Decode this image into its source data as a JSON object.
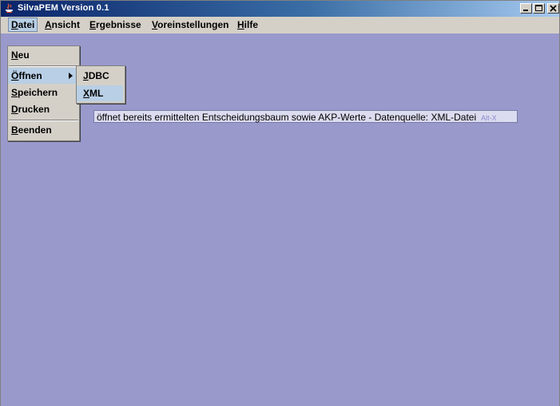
{
  "window": {
    "title": "SilvaPEM Version 0.1",
    "app_icon": "java-coffee-icon"
  },
  "titlebar_buttons": {
    "minimize": "minimize-icon",
    "maximize": "maximize-icon",
    "close": "close-icon"
  },
  "menubar": {
    "items": [
      {
        "label_key": "D",
        "label_rest": "atei"
      },
      {
        "label_key": "A",
        "label_rest": "nsicht"
      },
      {
        "label_key": "E",
        "label_rest": "rgebnisse"
      },
      {
        "label_key": "V",
        "label_rest": "oreinstellungen"
      },
      {
        "label_key": "H",
        "label_rest": "ilfe"
      }
    ]
  },
  "datei_menu": {
    "items": [
      {
        "label_key": "N",
        "label_rest": "eu"
      },
      {
        "label_key": "Ö",
        "label_rest": "ffnen"
      },
      {
        "label_key": "S",
        "label_rest": "peichern"
      },
      {
        "label_key": "D",
        "label_rest": "rucken"
      },
      {
        "label_key": "B",
        "label_rest": "eenden"
      }
    ]
  },
  "open_submenu": {
    "items": [
      {
        "label_key": "J",
        "label_rest": "DBC"
      },
      {
        "label_key": "X",
        "label_rest": "ML"
      }
    ]
  },
  "tooltip": {
    "text": "öffnet bereits ermittelten Entscheidungsbaum sowie AKP-Werte - Datenquelle: XML-Datei",
    "accelerator": "Alt-X"
  },
  "colors": {
    "desktop": "#9999cc",
    "selection": "#b8cfe5",
    "menu_bg": "#d4d0c8"
  }
}
